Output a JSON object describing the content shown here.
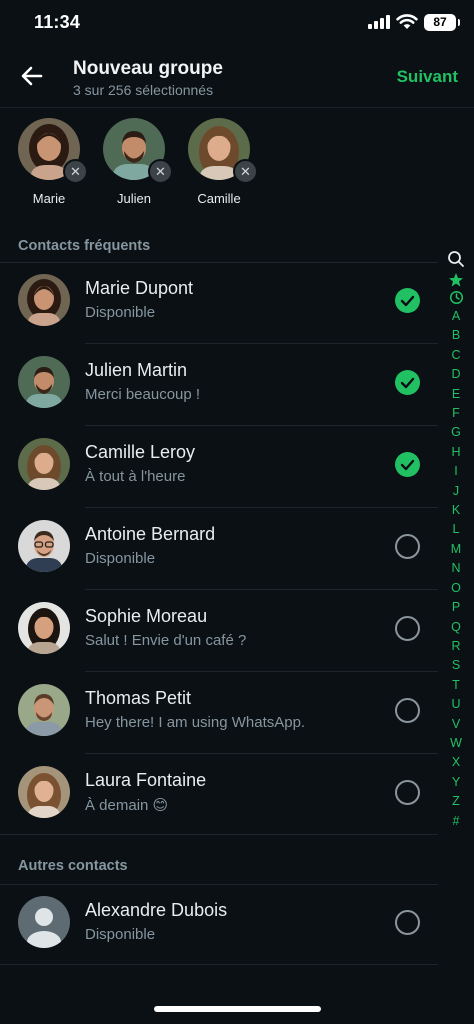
{
  "status_bar": {
    "time": "11:34",
    "battery": "87"
  },
  "header": {
    "title": "Nouveau groupe",
    "subtitle": "3 sur 256 sélectionnés",
    "next_label": "Suivant"
  },
  "selected": [
    {
      "name": "Marie"
    },
    {
      "name": "Julien"
    },
    {
      "name": "Camille"
    }
  ],
  "sections": {
    "frequent": "Contacts fréquents",
    "others": "Autres contacts"
  },
  "frequent_contacts": [
    {
      "name": "Marie Dupont",
      "status": "Disponible",
      "selected": true
    },
    {
      "name": "Julien Martin",
      "status": "Merci beaucoup !",
      "selected": true
    },
    {
      "name": "Camille Leroy",
      "status": "À tout à l'heure",
      "selected": true
    },
    {
      "name": "Antoine Bernard",
      "status": "Disponible",
      "selected": false
    },
    {
      "name": "Sophie Moreau",
      "status": "Salut ! Envie d'un café ?",
      "selected": false
    },
    {
      "name": "Thomas Petit",
      "status": "Hey there! I am using WhatsApp.",
      "selected": false
    },
    {
      "name": "Laura Fontaine",
      "status": "À demain 😊",
      "selected": false
    }
  ],
  "other_contacts": [
    {
      "name": "Alexandre Dubois",
      "status": "Disponible",
      "selected": false
    }
  ],
  "index_letters": [
    "A",
    "B",
    "C",
    "D",
    "E",
    "F",
    "G",
    "H",
    "I",
    "J",
    "K",
    "L",
    "M",
    "N",
    "O",
    "P",
    "Q",
    "R",
    "S",
    "T",
    "U",
    "V",
    "W",
    "X",
    "Y",
    "Z",
    "#"
  ],
  "colors": {
    "accent": "#21c063",
    "background": "#0b1014",
    "secondary_text": "#8696a0"
  }
}
